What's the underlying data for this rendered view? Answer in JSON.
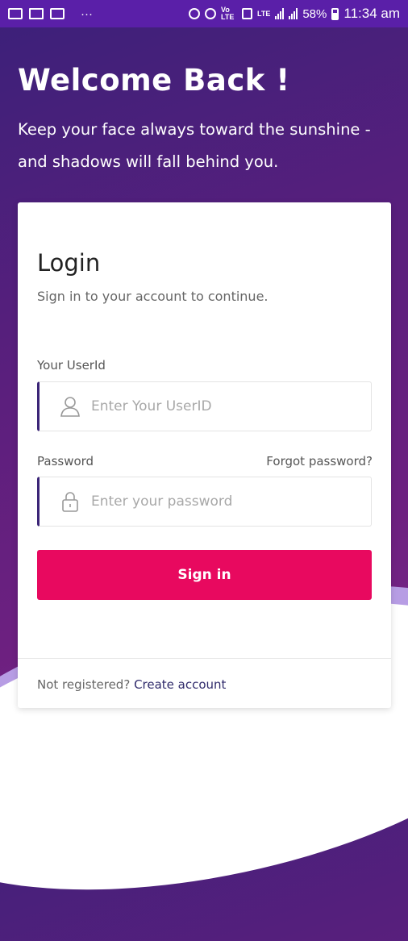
{
  "status_bar": {
    "notifications": [
      "gallery-icon",
      "laptop-icon",
      "mail-icon"
    ],
    "more": "···",
    "network_labels": [
      "Vo LTE",
      "LTE"
    ],
    "battery_percent": "58%",
    "time": "11:34 am"
  },
  "header": {
    "title": "Welcome Back !",
    "quote": "Keep your face always toward the sunshine - and shadows will fall behind you."
  },
  "login": {
    "title": "Login",
    "subtitle": "Sign in to your account to continue.",
    "userid_label": "Your UserId",
    "userid_placeholder": "Enter Your UserID",
    "password_label": "Password",
    "forgot_label": "Forgot password?",
    "password_placeholder": "Enter your password",
    "signin_label": "Sign in",
    "footer_text": "Not registered?",
    "create_account_label": "Create account"
  },
  "colors": {
    "accent": "#e8095f",
    "status_bar": "#5a1fa8",
    "field_border": "#3b2577"
  }
}
